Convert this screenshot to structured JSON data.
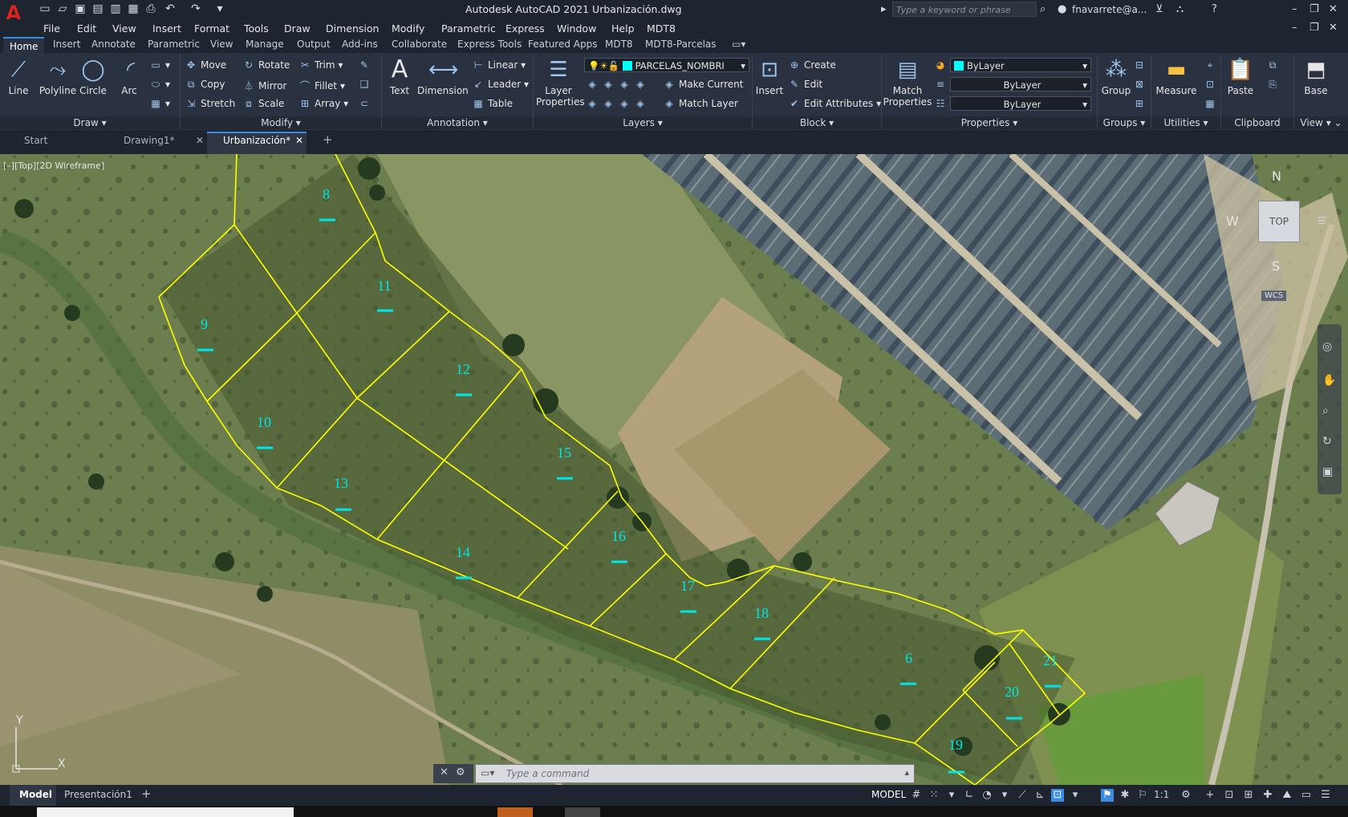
{
  "title_bar": {
    "app_title": "Autodesk AutoCAD 2021    Urbanización.dwg",
    "search_placeholder": "Type a keyword or phrase",
    "user": "fnavarrete@a..."
  },
  "menu": [
    "File",
    "Edit",
    "View",
    "Insert",
    "Format",
    "Tools",
    "Draw",
    "Dimension",
    "Modify",
    "Parametric",
    "Express",
    "Window",
    "Help",
    "MDT8"
  ],
  "ribbon_tabs": [
    "Home",
    "Insert",
    "Annotate",
    "Parametric",
    "View",
    "Manage",
    "Output",
    "Add-ins",
    "Collaborate",
    "Express Tools",
    "Featured Apps",
    "MDT8",
    "MDT8-Parcelas"
  ],
  "ribbon": {
    "draw": {
      "title": "Draw",
      "line": "Line",
      "polyline": "Polyline",
      "circle": "Circle",
      "arc": "Arc"
    },
    "modify": {
      "title": "Modify",
      "move": "Move",
      "rotate": "Rotate",
      "trim": "Trim",
      "copy": "Copy",
      "mirror": "Mirror",
      "fillet": "Fillet",
      "stretch": "Stretch",
      "scale": "Scale",
      "array": "Array"
    },
    "annotation": {
      "title": "Annotation",
      "text": "Text",
      "dimension": "Dimension",
      "linear": "Linear",
      "leader": "Leader",
      "table": "Table"
    },
    "layers": {
      "title": "Layers",
      "layer_properties": "Layer Properties",
      "current_layer": "PARCELAS_NOMBRI",
      "make_current": "Make Current",
      "match_layer": "Match Layer"
    },
    "block": {
      "title": "Block",
      "insert": "Insert",
      "create": "Create",
      "edit": "Edit",
      "edit_attributes": "Edit Attributes"
    },
    "properties": {
      "title": "Properties",
      "match_properties": "Match Properties",
      "color": "ByLayer",
      "linetype": "ByLayer",
      "lineweight": "ByLayer"
    },
    "groups": {
      "title": "Groups",
      "group": "Group"
    },
    "utilities": {
      "title": "Utilities",
      "measure": "Measure"
    },
    "clipboard": {
      "title": "Clipboard",
      "paste": "Paste"
    },
    "view": {
      "title": "View",
      "base": "Base"
    }
  },
  "doc_tabs": [
    {
      "label": "Start"
    },
    {
      "label": "Drawing1*"
    },
    {
      "label": "Urbanización*"
    }
  ],
  "viewport": {
    "label": "[–][Top][2D Wireframe]",
    "viewcube": {
      "top": "TOP",
      "n": "N",
      "s": "S",
      "w": "W",
      "wcs": "WCS"
    },
    "ucs": {
      "x": "X",
      "y": "Y"
    },
    "parcel_labels": [
      "8",
      "9",
      "11",
      "10",
      "12",
      "13",
      "15",
      "14",
      "16",
      "17",
      "18",
      "6",
      "20",
      "21",
      "19"
    ]
  },
  "command_line": {
    "placeholder": "Type  a  command"
  },
  "status": {
    "model_tab": "Model",
    "layout_tab": "Presentación1",
    "model": "MODEL",
    "scale": "1:1"
  },
  "colors": {
    "parcel_line": "#ffff00",
    "label": "#00e5e5",
    "accent": "#3a8dde"
  }
}
